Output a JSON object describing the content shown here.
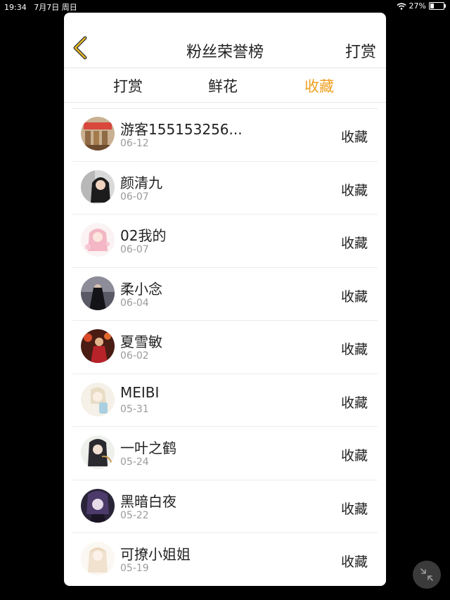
{
  "status_bar": {
    "time": "19:34",
    "date": "7月7日 周日",
    "battery_text": "27%",
    "battery_level": 0.27
  },
  "header": {
    "title": "粉丝荣誉榜",
    "action_label": "打赏",
    "back_icon": "chevron-left-icon"
  },
  "tabs": [
    {
      "label": "打赏",
      "active": false
    },
    {
      "label": "鲜花",
      "active": false
    },
    {
      "label": "收藏",
      "active": true
    }
  ],
  "colors": {
    "accent": "#f0a020",
    "text": "#222222",
    "secondary": "#9a9a9a",
    "backdrop": "#000000"
  },
  "list": [
    {
      "name": "游客155153256...",
      "date": "06-12",
      "badge": "收藏"
    },
    {
      "name": "颜清九",
      "date": "06-07",
      "badge": "收藏"
    },
    {
      "name": "02我的",
      "date": "06-07",
      "badge": "收藏"
    },
    {
      "name": "柔小念",
      "date": "06-04",
      "badge": "收藏"
    },
    {
      "name": "夏雪敏",
      "date": "06-02",
      "badge": "收藏"
    },
    {
      "name": "MEIBI",
      "date": "05-31",
      "badge": "收藏"
    },
    {
      "name": "一叶之鹤",
      "date": "05-24",
      "badge": "收藏"
    },
    {
      "name": "黑暗白夜",
      "date": "05-22",
      "badge": "收藏"
    },
    {
      "name": "可撩小姐姐",
      "date": "05-19",
      "badge": "收藏"
    }
  ],
  "floating_button": {
    "icon": "collapse-arrows-icon"
  }
}
